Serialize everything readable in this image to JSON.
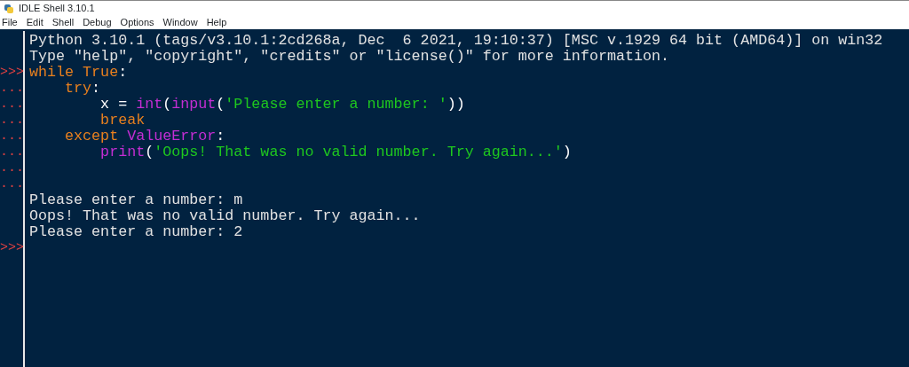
{
  "window": {
    "title": "IDLE Shell 3.10.1"
  },
  "menu": [
    "File",
    "Edit",
    "Shell",
    "Debug",
    "Options",
    "Window",
    "Help"
  ],
  "lines": [
    {
      "segments": [
        {
          "kind": "output",
          "text": "Python 3.10.1 (tags/v3.10.1:2cd268a, Dec  6 2021, 19:10:37) [MSC v.1929 64 bit (AMD64)] on win32"
        }
      ]
    },
    {
      "segments": [
        {
          "kind": "output",
          "text": "Type \"help\", \"copyright\", \"credits\" or \"license()\" for more information."
        }
      ]
    },
    {
      "prompt": ">>>",
      "segments": [
        {
          "kind": "keyword",
          "text": "while True"
        },
        {
          "kind": "plain",
          "text": ":"
        }
      ]
    },
    {
      "prompt": "...",
      "segments": [
        {
          "kind": "keyword",
          "text": "    try"
        },
        {
          "kind": "plain",
          "text": ":"
        }
      ]
    },
    {
      "prompt": "...",
      "segments": [
        {
          "kind": "plain",
          "text": "        x = "
        },
        {
          "kind": "builtin",
          "text": "int"
        },
        {
          "kind": "plain",
          "text": "("
        },
        {
          "kind": "builtin",
          "text": "input"
        },
        {
          "kind": "plain",
          "text": "("
        },
        {
          "kind": "string",
          "text": "'Please enter a number: '"
        },
        {
          "kind": "plain",
          "text": "))"
        }
      ]
    },
    {
      "prompt": "...",
      "segments": [
        {
          "kind": "keyword",
          "text": "        break"
        }
      ]
    },
    {
      "prompt": "...",
      "segments": [
        {
          "kind": "keyword",
          "text": "    except "
        },
        {
          "kind": "builtin",
          "text": "ValueError"
        },
        {
          "kind": "plain",
          "text": ":"
        }
      ]
    },
    {
      "prompt": "...",
      "segments": [
        {
          "kind": "builtin",
          "text": "        print"
        },
        {
          "kind": "plain",
          "text": "("
        },
        {
          "kind": "string",
          "text": "'Oops! That was no valid number. Try again...'"
        },
        {
          "kind": "plain",
          "text": ")"
        }
      ]
    },
    {
      "prompt": "..."
    },
    {
      "prompt": "..."
    },
    {
      "segments": [
        {
          "kind": "output",
          "text": "Please enter a number: m"
        }
      ]
    },
    {
      "segments": [
        {
          "kind": "output",
          "text": "Oops! That was no valid number. Try again..."
        }
      ]
    },
    {
      "segments": [
        {
          "kind": "output",
          "text": "Please enter a number: 2"
        }
      ]
    },
    {
      "prompt": ">>>"
    }
  ]
}
